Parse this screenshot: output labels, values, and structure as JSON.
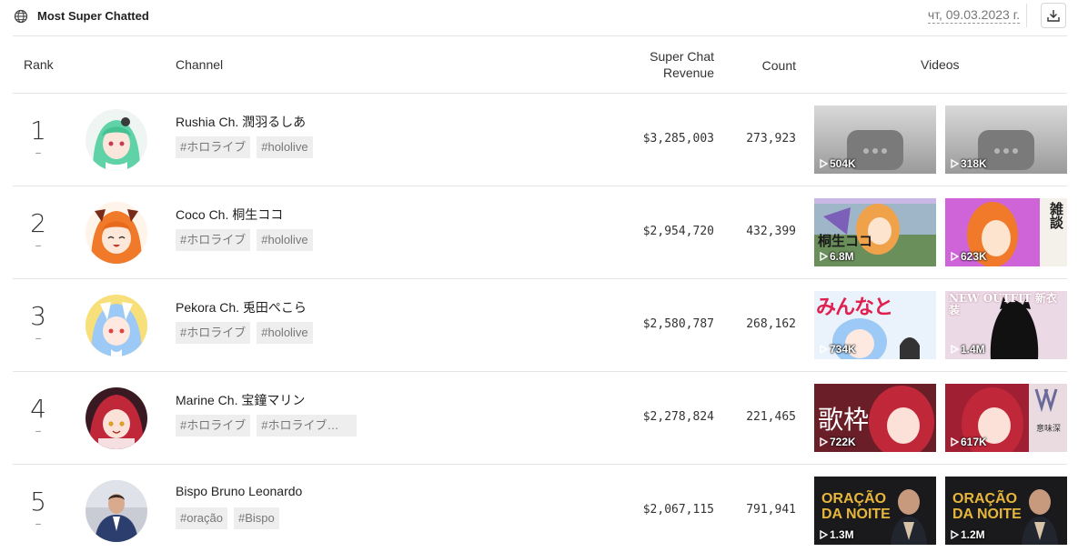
{
  "header": {
    "title": "Most Super Chatted",
    "date": "чт, 09.03.2023 г."
  },
  "columns": {
    "rank": "Rank",
    "channel": "Channel",
    "revenue": "Super Chat Revenue",
    "count": "Count",
    "videos": "Videos"
  },
  "rows": [
    {
      "rank": "1",
      "trend": "–",
      "channel": "Rushia Ch. 潤羽るしあ",
      "tags": [
        "#ホロライブ",
        "#hololive"
      ],
      "revenue": "$3,285,003",
      "count": "273,923",
      "videos": [
        {
          "views": "504K"
        },
        {
          "views": "318K"
        }
      ]
    },
    {
      "rank": "2",
      "trend": "–",
      "channel": "Coco Ch. 桐生ココ",
      "tags": [
        "#ホロライブ",
        "#hololive"
      ],
      "revenue": "$2,954,720",
      "count": "432,399",
      "videos": [
        {
          "views": "6.8M",
          "text": "桐生ココ"
        },
        {
          "views": "623K",
          "text": "雑談"
        }
      ]
    },
    {
      "rank": "3",
      "trend": "–",
      "channel": "Pekora Ch. 兎田ぺこら",
      "tags": [
        "#ホロライブ",
        "#hololive"
      ],
      "revenue": "$2,580,787",
      "count": "268,162",
      "videos": [
        {
          "views": "734K",
          "text": "みんなと"
        },
        {
          "views": "1.4M",
          "text": "NEW OUTFIT 新衣装"
        }
      ]
    },
    {
      "rank": "4",
      "trend": "–",
      "channel": "Marine Ch. 宝鐘マリン",
      "tags": [
        "#ホロライブ",
        "#ホロライブ…"
      ],
      "revenue": "$2,278,824",
      "count": "221,465",
      "videos": [
        {
          "views": "722K",
          "text": "歌枠"
        },
        {
          "views": "617K",
          "text": "意味深"
        }
      ]
    },
    {
      "rank": "5",
      "trend": "–",
      "channel": "Bispo Bruno Leonardo",
      "tags": [
        "#oração",
        "#Bispo"
      ],
      "revenue": "$2,067,115",
      "count": "791,941",
      "videos": [
        {
          "views": "1.3M",
          "text": "ORAÇÃO DA NOITE"
        },
        {
          "views": "1.2M",
          "text": "ORAÇÃO DA NOITE"
        }
      ]
    }
  ],
  "colors": {
    "rushia": "#5fd3a7",
    "coco": "#f07a2a",
    "pekora": "#9cc9f5",
    "marine": "#c0283a",
    "bispo": "#2c3e6e"
  }
}
